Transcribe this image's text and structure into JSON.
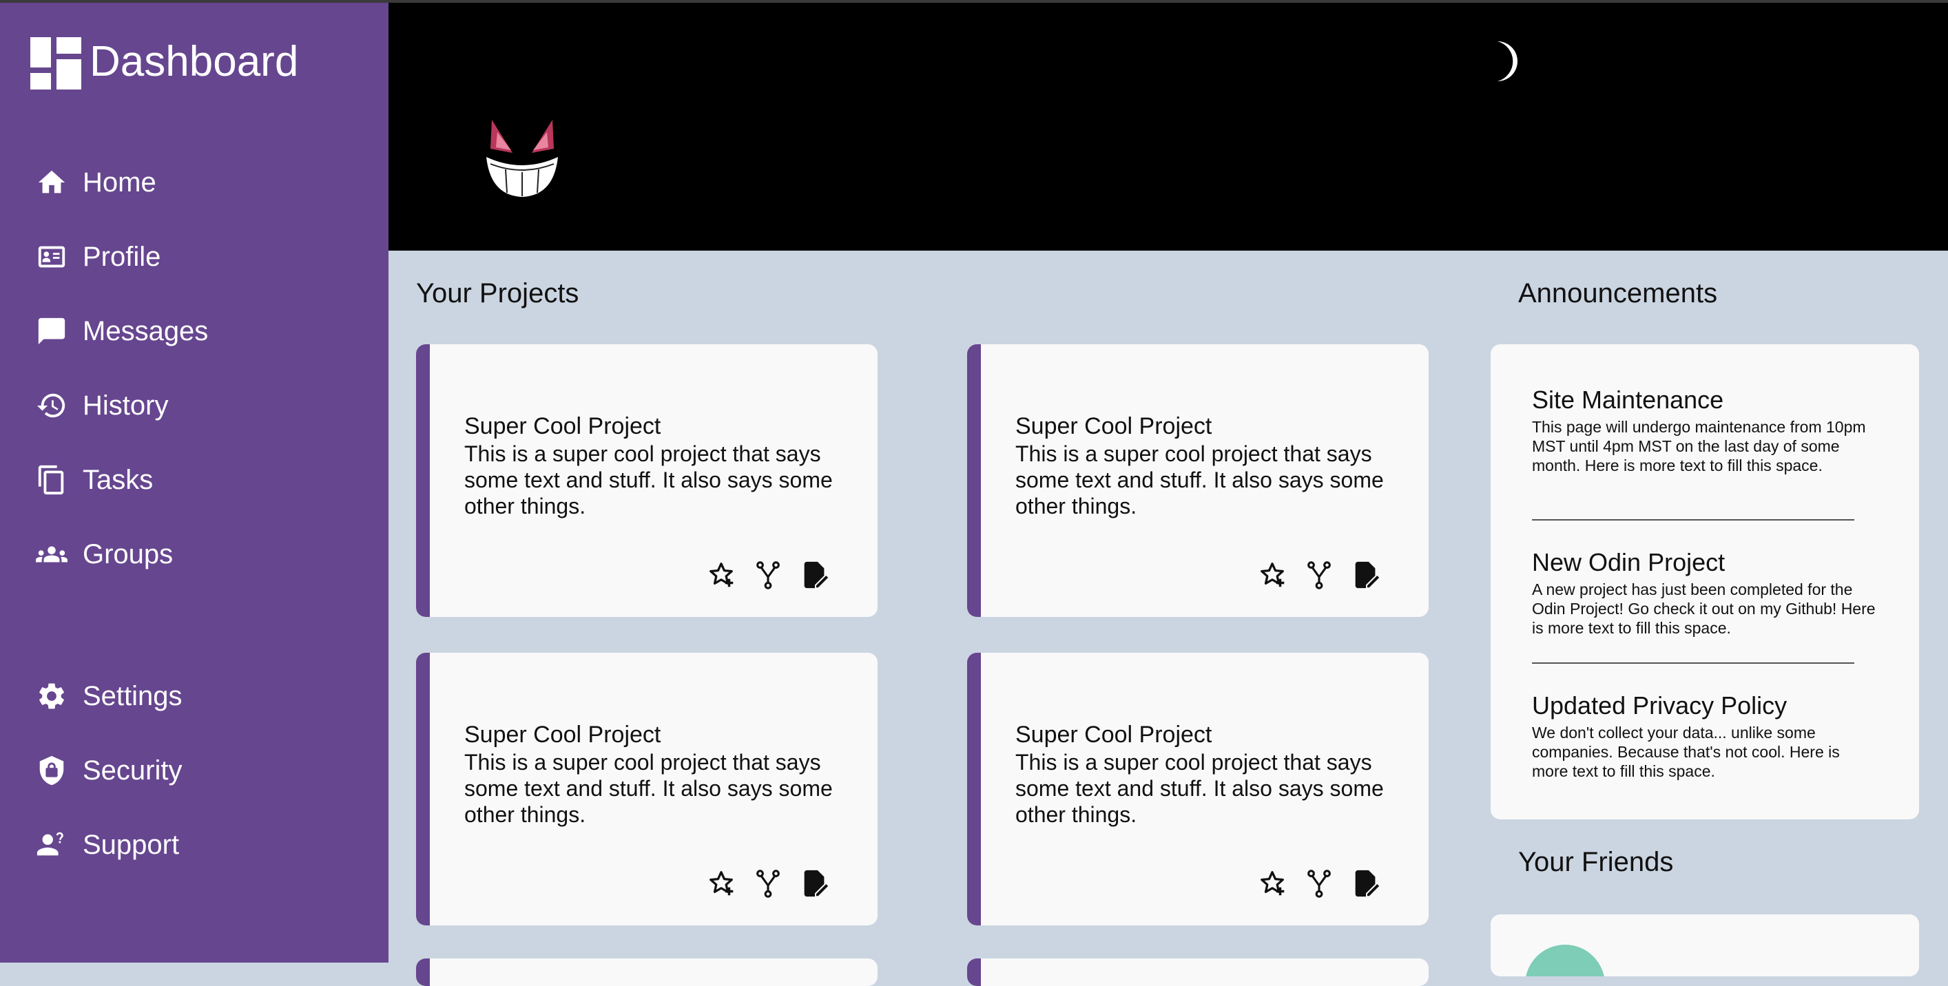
{
  "sidebar": {
    "title": "Dashboard",
    "items": [
      {
        "label": "Home",
        "icon": "home-icon"
      },
      {
        "label": "Profile",
        "icon": "profile-card-icon"
      },
      {
        "label": "Messages",
        "icon": "message-icon"
      },
      {
        "label": "History",
        "icon": "history-icon"
      },
      {
        "label": "Tasks",
        "icon": "tasks-icon"
      },
      {
        "label": "Groups",
        "icon": "groups-icon"
      }
    ],
    "bottom_items": [
      {
        "label": "Settings",
        "icon": "gear-icon"
      },
      {
        "label": "Security",
        "icon": "shield-lock-icon"
      },
      {
        "label": "Support",
        "icon": "support-icon"
      }
    ]
  },
  "header": {
    "theme_toggle_icon": "moon-icon",
    "logo_icon": "gengar-face-icon"
  },
  "projects": {
    "heading": "Your Projects",
    "cards": [
      {
        "title": "Super Cool Project",
        "description": "This is a super cool project that says some text and stuff. It also says some other things."
      },
      {
        "title": "Super Cool Project",
        "description": "This is a super cool project that says some text and stuff. It also says some other things."
      },
      {
        "title": "Super Cool Project",
        "description": "This is a super cool project that says some text and stuff. It also says some other things."
      },
      {
        "title": "Super Cool Project",
        "description": "This is a super cool project that says some text and stuff. It also says some other things."
      }
    ],
    "card_actions": [
      "star-add-icon",
      "fork-icon",
      "edit-file-icon"
    ]
  },
  "announcements": {
    "heading": "Announcements",
    "items": [
      {
        "title": "Site Maintenance",
        "text": "This page will undergo maintenance from 10pm MST until 4pm MST on the last day of some month. Here is more text to fill this space."
      },
      {
        "title": "New Odin Project",
        "text": "A new project has just been completed for the Odin Project! Go check it out on my Github! Here is more text to fill this space."
      },
      {
        "title": "Updated Privacy Policy",
        "text": "We don't collect your data... unlike some companies. Because that's not cool. Here is more text to fill this space."
      }
    ]
  },
  "friends": {
    "heading": "Your Friends"
  },
  "colors": {
    "sidebar": "#66468f",
    "content_bg": "#cbd5e1",
    "header_bg": "#000000",
    "card_bg": "#f9f9f9",
    "accent": "#66468f"
  }
}
